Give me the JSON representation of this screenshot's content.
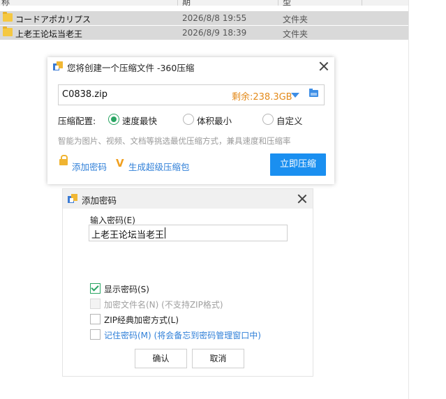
{
  "explorer": {
    "header_fragments": [
      "称",
      "期",
      "型"
    ],
    "rows": [
      {
        "name": "コードアポカリプス",
        "date": "2026/8/8 19:55",
        "type": "文件夹"
      },
      {
        "name": "上老王论坛当老王",
        "date": "2026/8/9 18:39",
        "type": "文件夹"
      }
    ]
  },
  "compress_dialog": {
    "title": "您将创建一个压缩文件 -360压缩",
    "file_name": "C0838.zip",
    "free_space": "剩余:238.3GB",
    "config_label": "压缩配置:",
    "options": [
      {
        "label": "速度最快",
        "selected": true
      },
      {
        "label": "体积最小",
        "selected": false
      },
      {
        "label": "自定义",
        "selected": false
      }
    ],
    "hint": "智能为图片、视频、文档等挑选最优压缩方式，兼具速度和压缩率",
    "add_password": "添加密码",
    "super_pack": "生成超级压缩包",
    "compress_now": "立即压缩",
    "v_glyph": "V"
  },
  "password_dialog": {
    "title": "添加密码",
    "input_label": "输入密码(E)",
    "password_value": "上老王论坛当老王",
    "checkboxes": [
      {
        "label": "显示密码(S)",
        "checked": true,
        "disabled": false
      },
      {
        "label": "加密文件名(N) (不支持ZIP格式)",
        "checked": false,
        "disabled": true
      },
      {
        "label": "ZIP经典加密方式(L)",
        "checked": false,
        "disabled": false
      },
      {
        "label": "记住密码(M) (将会备忘到密码管理窗口中)",
        "checked": false,
        "disabled": false
      }
    ],
    "ok_label": "确认",
    "cancel_label": "取消"
  },
  "colors": {
    "accent_blue": "#1a8ff0",
    "link_blue": "#2f7fd8",
    "radio_green": "#2aa563",
    "space_orange": "#e38a1a"
  }
}
